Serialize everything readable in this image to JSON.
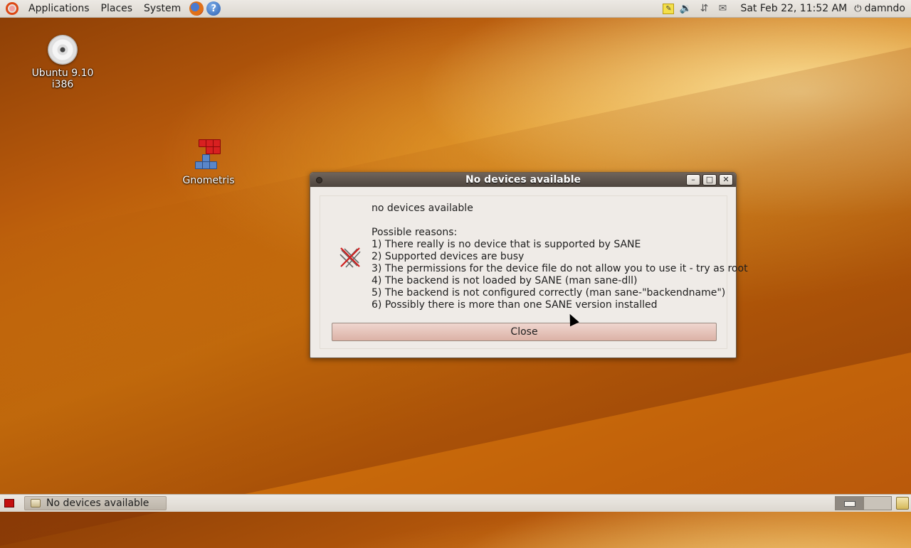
{
  "top_panel": {
    "menus": [
      "Applications",
      "Places",
      "System"
    ],
    "clock": "Sat Feb 22, 11:52 AM",
    "user": "damndo",
    "tray_icons": [
      "notes-icon",
      "volume-icon",
      "network-icon",
      "mail-icon"
    ]
  },
  "desktop": {
    "icons": [
      {
        "label": "Ubuntu 9.10 i386",
        "icon": "cd-icon"
      },
      {
        "label": "Gnometris",
        "icon": "gnometris-icon"
      }
    ]
  },
  "dialog": {
    "title": "No devices available",
    "heading": "no devices available",
    "reasons_title": "Possible reasons:",
    "reasons": [
      "1) There really is no device that is supported by SANE",
      "2) Supported devices are busy",
      "3) The permissions for the device file do not allow you to use it - try as root",
      "4) The backend is not loaded by SANE (man sane-dll)",
      "5) The backend is not configured correctly (man sane-\"backendname\")",
      "6) Possibly there is more than one SANE version installed"
    ],
    "close_label": "Close",
    "window_buttons": {
      "minimize": "–",
      "maximize": "□",
      "close": "✕"
    }
  },
  "bottom_panel": {
    "task": "No devices available"
  },
  "colors": {
    "panel_bg": "#dcd7cf",
    "titlebar": "#4e453e",
    "dialog_bg": "#efebe7",
    "button_bg": "#dcb2a6"
  }
}
